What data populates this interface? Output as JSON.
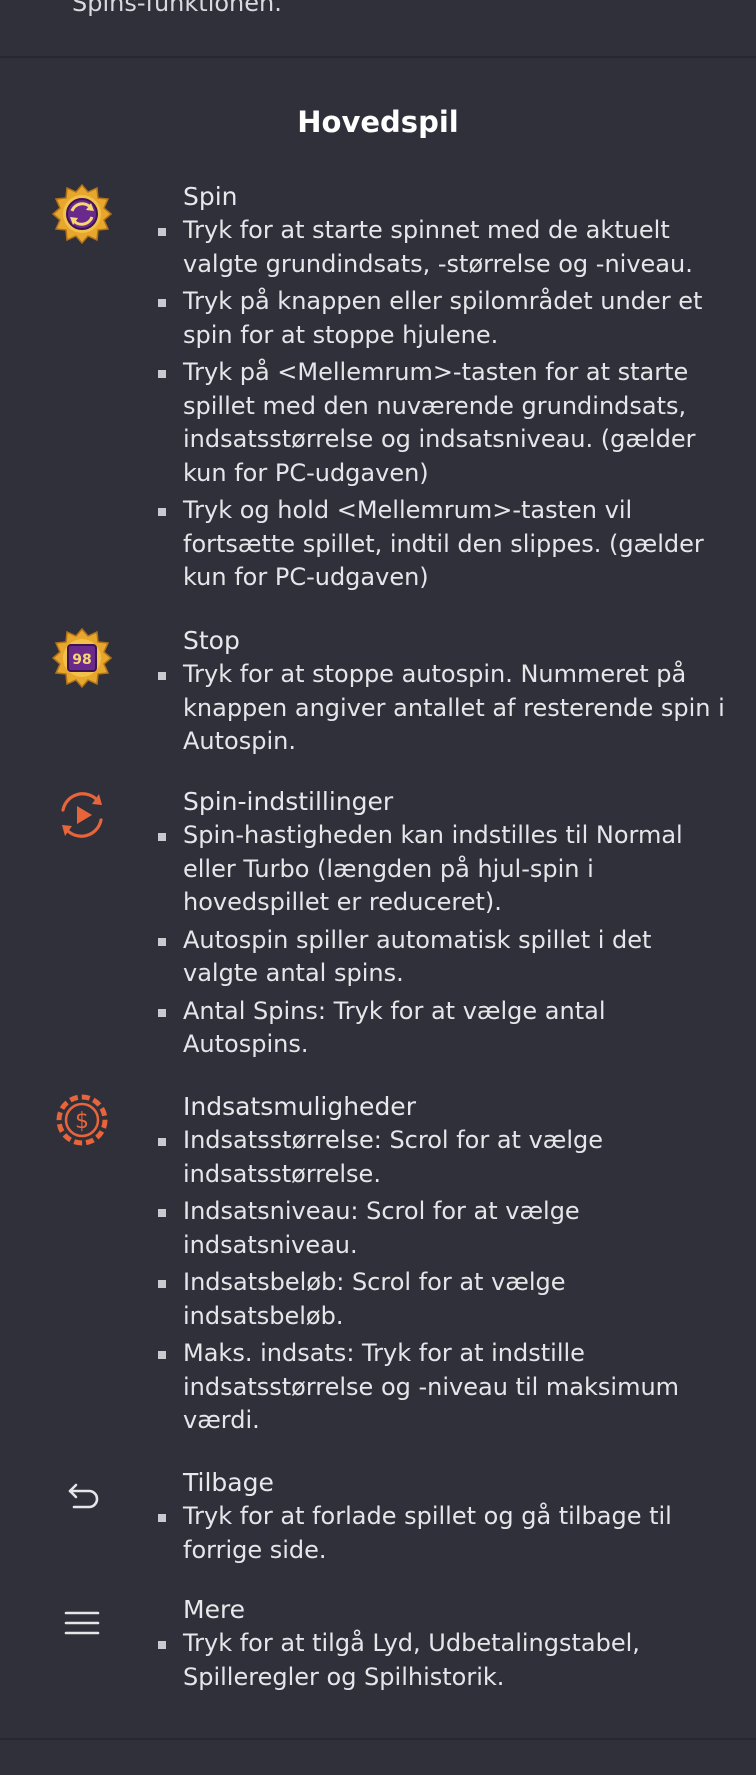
{
  "top_fragment": "Spins-funktionen.",
  "section_title": "Hovedspil",
  "colors": {
    "background": "#30303a",
    "divider": "#272730",
    "accent_orange": "#e8643a",
    "gold": "#e7a62c",
    "purple": "#6a2a8c"
  },
  "entries": [
    {
      "icon": "spin-gold-icon",
      "title": "Spin",
      "items": [
        "Tryk for at starte spinnet med de aktuelt valgte grundindsats, -størrelse og -niveau.",
        "Tryk på knappen eller spilområdet under et spin for at stoppe hjulene.",
        "Tryk på <Mellemrum>-tasten for at starte spillet med den nuværende grundindsats, indsatsstørrelse og indsatsniveau. (gælder kun for PC-udgaven)",
        "Tryk og hold <Mellemrum>-tasten vil fortsætte spillet, indtil den slippes. (gælder kun for PC-udgaven)"
      ]
    },
    {
      "icon": "stop-gold-icon",
      "icon_label": "98",
      "title": "Stop",
      "items": [
        "Tryk for at stoppe autospin. Nummeret på knappen angiver antallet af resterende spin i Autospin."
      ]
    },
    {
      "icon": "spin-settings-icon",
      "title": "Spin-indstillinger",
      "items": [
        "Spin-hastigheden kan indstilles til Normal eller Turbo (længden på hjul-spin i hovedspillet er reduceret).",
        "Autospin spiller automatisk spillet i det valgte antal spins.",
        "Antal Spins: Tryk for at vælge antal Autospins."
      ]
    },
    {
      "icon": "bet-options-icon",
      "title": "Indsatsmuligheder",
      "items": [
        "Indsatsstørrelse: Scrol for at vælge indsatsstørrelse.",
        "Indsatsniveau: Scrol for at vælge indsatsniveau.",
        "Indsatsbeløb: Scrol for at vælge indsatsbeløb.",
        "Maks. indsats: Tryk for at indstille indsatsstørrelse og -niveau til maksimum værdi."
      ]
    },
    {
      "icon": "back-arrow-icon",
      "title": "Tilbage",
      "items": [
        "Tryk for at forlade spillet og gå tilbage til forrige side."
      ]
    },
    {
      "icon": "menu-icon",
      "title": "Mere",
      "items": [
        "Tryk for at tilgå Lyd, Udbetalingstabel, Spilleregler og Spilhistorik."
      ]
    }
  ]
}
